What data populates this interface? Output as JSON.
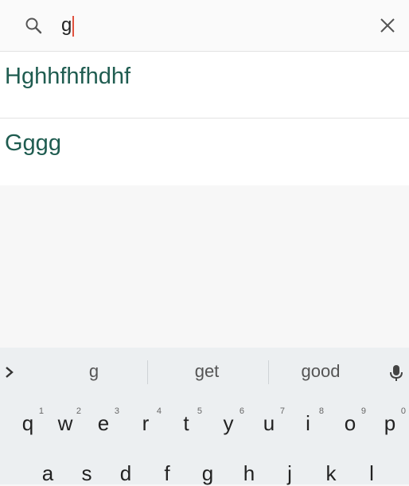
{
  "search": {
    "query": "g"
  },
  "results": [
    {
      "label": "Hghhfhfhdhf"
    },
    {
      "label": "Gggg"
    }
  ],
  "keyboard": {
    "suggestions": [
      "g",
      "get",
      "good"
    ],
    "row1": [
      {
        "key": "q",
        "num": "1"
      },
      {
        "key": "w",
        "num": "2"
      },
      {
        "key": "e",
        "num": "3"
      },
      {
        "key": "r",
        "num": "4"
      },
      {
        "key": "t",
        "num": "5"
      },
      {
        "key": "y",
        "num": "6"
      },
      {
        "key": "u",
        "num": "7"
      },
      {
        "key": "i",
        "num": "8"
      },
      {
        "key": "o",
        "num": "9"
      },
      {
        "key": "p",
        "num": "0"
      }
    ],
    "row2": [
      "a",
      "s",
      "d",
      "f",
      "g",
      "h",
      "j",
      "k",
      "l"
    ]
  },
  "colors": {
    "result_text": "#1f5c50",
    "caret": "#e0523f",
    "keyboard_bg": "#eceff1"
  },
  "icons": [
    "search-icon",
    "close-icon",
    "chevron-right-icon",
    "mic-icon"
  ]
}
